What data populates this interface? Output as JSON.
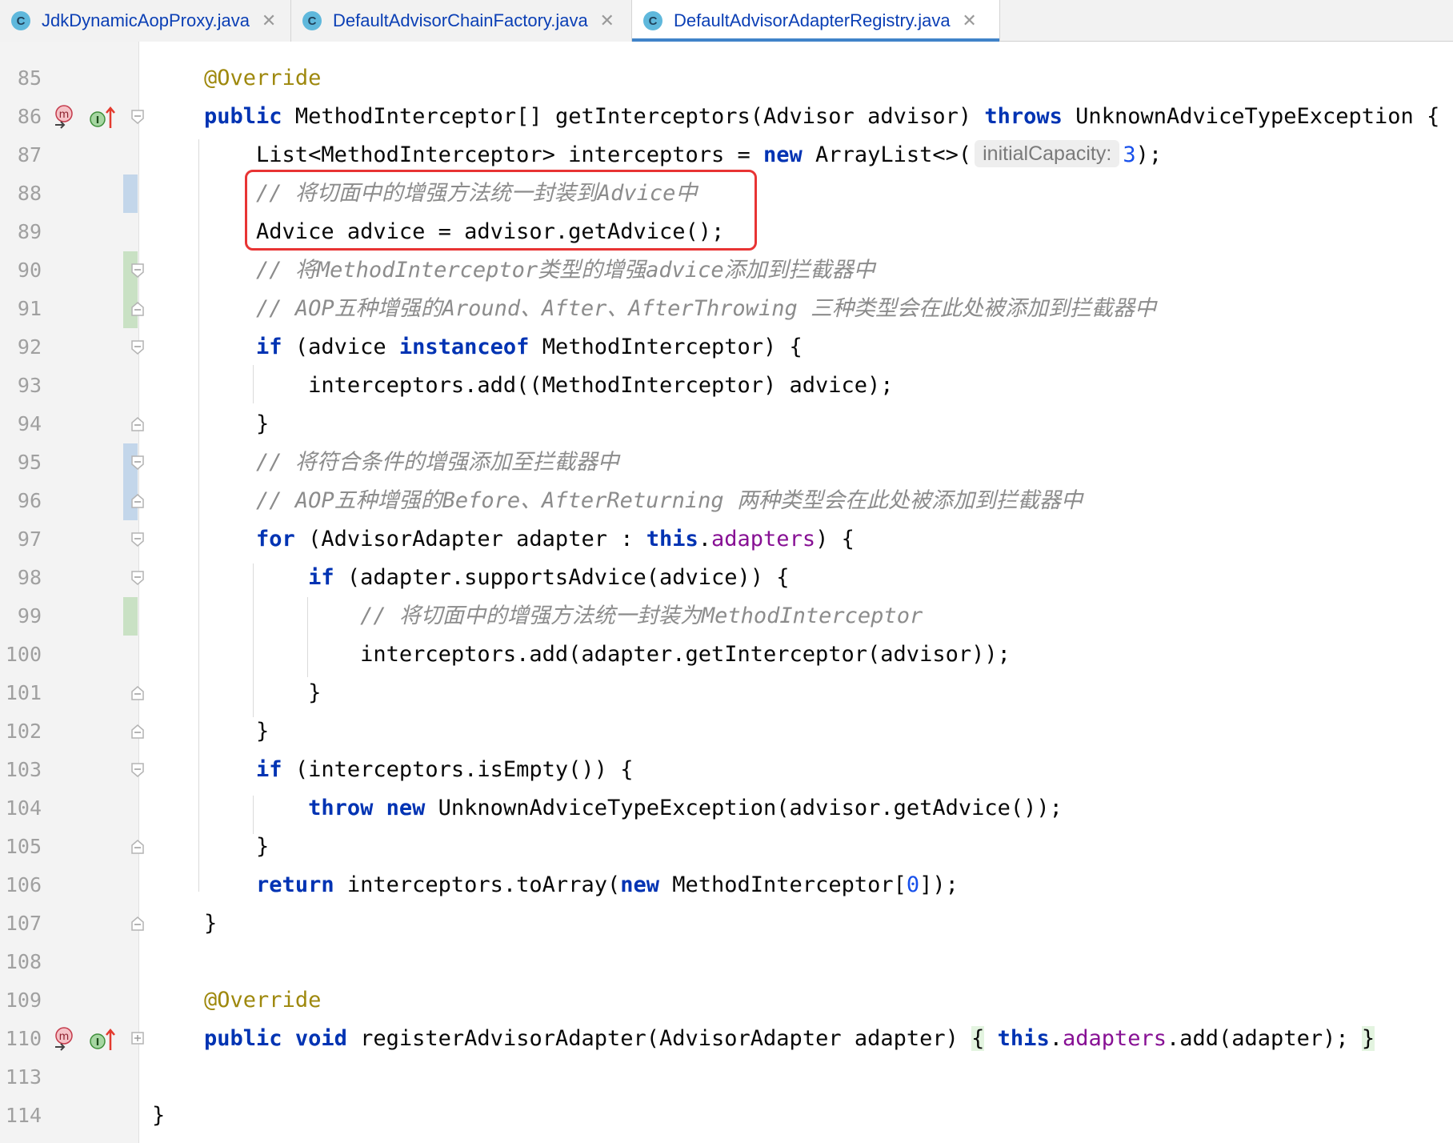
{
  "tabs": [
    {
      "label": "JdkDynamicAopProxy.java",
      "icon": "class-icon",
      "active": false
    },
    {
      "label": "DefaultAdvisorChainFactory.java",
      "icon": "class-icon",
      "active": false
    },
    {
      "label": "DefaultAdvisorAdapterRegistry.java",
      "icon": "class-icon",
      "active": true
    }
  ],
  "tab_icon_letter": "C",
  "tab_close_glyph": "✕",
  "gutter_icon_letters": {
    "method": "m",
    "implemented": "I"
  },
  "colors": {
    "keyword": "#0033b3",
    "annotation": "#9e880d",
    "comment": "#8c8c8c",
    "field": "#871094",
    "number": "#1750eb",
    "highlight_box": "#e83434",
    "active_tab_underline": "#4083c9"
  },
  "editor": {
    "lines": [
      {
        "no": "85",
        "segments": [
          {
            "t": "    "
          },
          {
            "t": "@Override",
            "c": "ann"
          }
        ]
      },
      {
        "no": "86",
        "segments": [
          {
            "t": "    "
          },
          {
            "t": "public",
            "c": "kw"
          },
          {
            "t": " MethodInterceptor[] getInterceptors(Advisor advisor) "
          },
          {
            "t": "throws",
            "c": "kw"
          },
          {
            "t": " UnknownAdviceTypeException {"
          }
        ]
      },
      {
        "no": "87",
        "segments": [
          {
            "t": "        List<MethodInterceptor> interceptors = "
          },
          {
            "t": "new",
            "c": "kw"
          },
          {
            "t": " ArrayList<>("
          },
          {
            "t": "initialCapacity:",
            "c": "hint"
          },
          {
            "t": "3",
            "c": "num"
          },
          {
            "t": ");"
          }
        ]
      },
      {
        "no": "88",
        "segments": [
          {
            "t": "        "
          },
          {
            "t": "// 将切面中的增强方法统一封装到Advice中",
            "c": "cm"
          }
        ]
      },
      {
        "no": "89",
        "segments": [
          {
            "t": "        Advice advice = advisor.getAdvice();"
          }
        ]
      },
      {
        "no": "90",
        "segments": [
          {
            "t": "        "
          },
          {
            "t": "// 将MethodInterceptor类型的增强advice添加到拦截器中",
            "c": "cm"
          }
        ]
      },
      {
        "no": "91",
        "segments": [
          {
            "t": "        "
          },
          {
            "t": "// AOP五种增强的Around、After、AfterThrowing 三种类型会在此处被添加到拦截器中",
            "c": "cm"
          }
        ]
      },
      {
        "no": "92",
        "segments": [
          {
            "t": "        "
          },
          {
            "t": "if",
            "c": "kw"
          },
          {
            "t": " (advice "
          },
          {
            "t": "instanceof",
            "c": "kw"
          },
          {
            "t": " MethodInterceptor) {"
          }
        ]
      },
      {
        "no": "93",
        "segments": [
          {
            "t": "            interceptors.add((MethodInterceptor) advice);"
          }
        ]
      },
      {
        "no": "94",
        "segments": [
          {
            "t": "        }"
          }
        ]
      },
      {
        "no": "95",
        "segments": [
          {
            "t": "        "
          },
          {
            "t": "// 将符合条件的增强添加至拦截器中",
            "c": "cm"
          }
        ]
      },
      {
        "no": "96",
        "segments": [
          {
            "t": "        "
          },
          {
            "t": "// AOP五种增强的Before、AfterReturning 两种类型会在此处被添加到拦截器中",
            "c": "cm"
          }
        ]
      },
      {
        "no": "97",
        "segments": [
          {
            "t": "        "
          },
          {
            "t": "for",
            "c": "kw"
          },
          {
            "t": " (AdvisorAdapter adapter : "
          },
          {
            "t": "this",
            "c": "kw"
          },
          {
            "t": "."
          },
          {
            "t": "adapters",
            "c": "fld"
          },
          {
            "t": ") {"
          }
        ]
      },
      {
        "no": "98",
        "segments": [
          {
            "t": "            "
          },
          {
            "t": "if",
            "c": "kw"
          },
          {
            "t": " (adapter.supportsAdvice(advice)) {"
          }
        ]
      },
      {
        "no": "99",
        "segments": [
          {
            "t": "                "
          },
          {
            "t": "// 将切面中的增强方法统一封装为MethodInterceptor",
            "c": "cm"
          }
        ]
      },
      {
        "no": "100",
        "segments": [
          {
            "t": "                interceptors.add(adapter.getInterceptor(advisor));"
          }
        ]
      },
      {
        "no": "101",
        "segments": [
          {
            "t": "            }"
          }
        ]
      },
      {
        "no": "102",
        "segments": [
          {
            "t": "        }"
          }
        ]
      },
      {
        "no": "103",
        "segments": [
          {
            "t": "        "
          },
          {
            "t": "if",
            "c": "kw"
          },
          {
            "t": " (interceptors.isEmpty()) {"
          }
        ]
      },
      {
        "no": "104",
        "segments": [
          {
            "t": "            "
          },
          {
            "t": "throw",
            "c": "kw"
          },
          {
            "t": " "
          },
          {
            "t": "new",
            "c": "kw"
          },
          {
            "t": " UnknownAdviceTypeException(advisor.getAdvice());"
          }
        ]
      },
      {
        "no": "105",
        "segments": [
          {
            "t": "        }"
          }
        ]
      },
      {
        "no": "106",
        "segments": [
          {
            "t": "        "
          },
          {
            "t": "return",
            "c": "kw"
          },
          {
            "t": " interceptors.toArray("
          },
          {
            "t": "new",
            "c": "kw"
          },
          {
            "t": " MethodInterceptor["
          },
          {
            "t": "0",
            "c": "num"
          },
          {
            "t": "]);"
          }
        ]
      },
      {
        "no": "107",
        "segments": [
          {
            "t": "    }"
          }
        ]
      },
      {
        "no": "108",
        "segments": []
      },
      {
        "no": "109",
        "segments": [
          {
            "t": "    "
          },
          {
            "t": "@Override",
            "c": "ann"
          }
        ]
      },
      {
        "no": "110",
        "segments": [
          {
            "t": "    "
          },
          {
            "t": "public",
            "c": "kw"
          },
          {
            "t": " "
          },
          {
            "t": "void",
            "c": "kw"
          },
          {
            "t": " registerAdvisorAdapter(AdvisorAdapter adapter) "
          },
          {
            "t": "{",
            "c": "brace-hl"
          },
          {
            "t": " "
          },
          {
            "t": "this",
            "c": "kw"
          },
          {
            "t": "."
          },
          {
            "t": "adapters",
            "c": "fld"
          },
          {
            "t": ".add(adapter); "
          },
          {
            "t": "}",
            "c": "brace-hl"
          }
        ]
      },
      {
        "no": "113",
        "segments": []
      },
      {
        "no": "114",
        "segments": [
          {
            "t": "}"
          }
        ]
      }
    ]
  }
}
